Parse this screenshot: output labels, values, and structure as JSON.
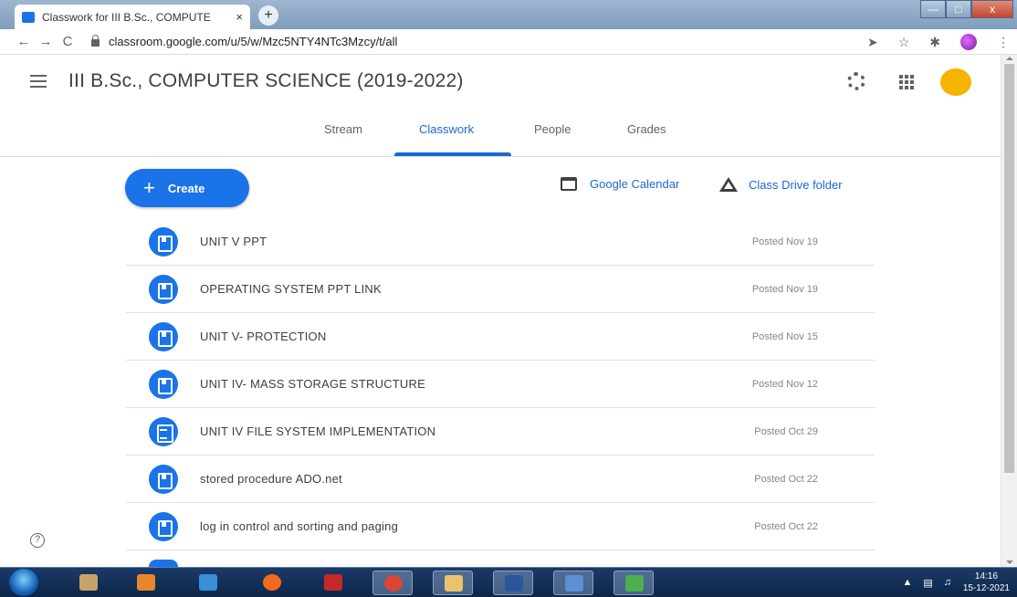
{
  "browser": {
    "tab_title": "Classwork for III B.Sc., COMPUTE",
    "tab_close": "×",
    "new_tab": "+",
    "url": "classroom.google.com/u/5/w/Mzc5NTY4NTc3Mzcy/t/all",
    "back": "←",
    "forward": "→",
    "reload": "C",
    "window_min": "—",
    "window_max": "□",
    "window_close": "x"
  },
  "header": {
    "class_title": "III B.Sc., COMPUTER SCIENCE (2019-2022)"
  },
  "tabs": [
    {
      "label": "Stream"
    },
    {
      "label": "Classwork"
    },
    {
      "label": "People"
    },
    {
      "label": "Grades"
    }
  ],
  "actions": {
    "create_label": "Create",
    "create_plus": "+",
    "calendar_label": "Google Calendar",
    "drive_label": "Class Drive folder"
  },
  "items": [
    {
      "title": "UNIT V PPT",
      "date": "Posted Nov 19",
      "icon": "material-icon"
    },
    {
      "title": "OPERATING SYSTEM PPT LINK",
      "date": "Posted Nov 19",
      "icon": "material-icon"
    },
    {
      "title": "UNIT V- PROTECTION",
      "date": "Posted Nov 15",
      "icon": "material-icon"
    },
    {
      "title": "UNIT IV- MASS STORAGE STRUCTURE",
      "date": "Posted Nov 12",
      "icon": "material-icon"
    },
    {
      "title": "UNIT IV FILE SYSTEM IMPLEMENTATION",
      "date": "Posted Oct 29",
      "icon": "assignment-icon"
    },
    {
      "title": "stored procedure ADO.net",
      "date": "Posted Oct 22",
      "icon": "material-icon"
    },
    {
      "title": "log in control and sorting and paging",
      "date": "Posted Oct 22",
      "icon": "material-icon"
    }
  ],
  "help": "?",
  "taskbar": {
    "time": "14:16",
    "date": "15-12-2021"
  },
  "colors": {
    "accent": "#1a73e8",
    "active_tab": "#1967d2",
    "avatar": "#f4b400"
  }
}
